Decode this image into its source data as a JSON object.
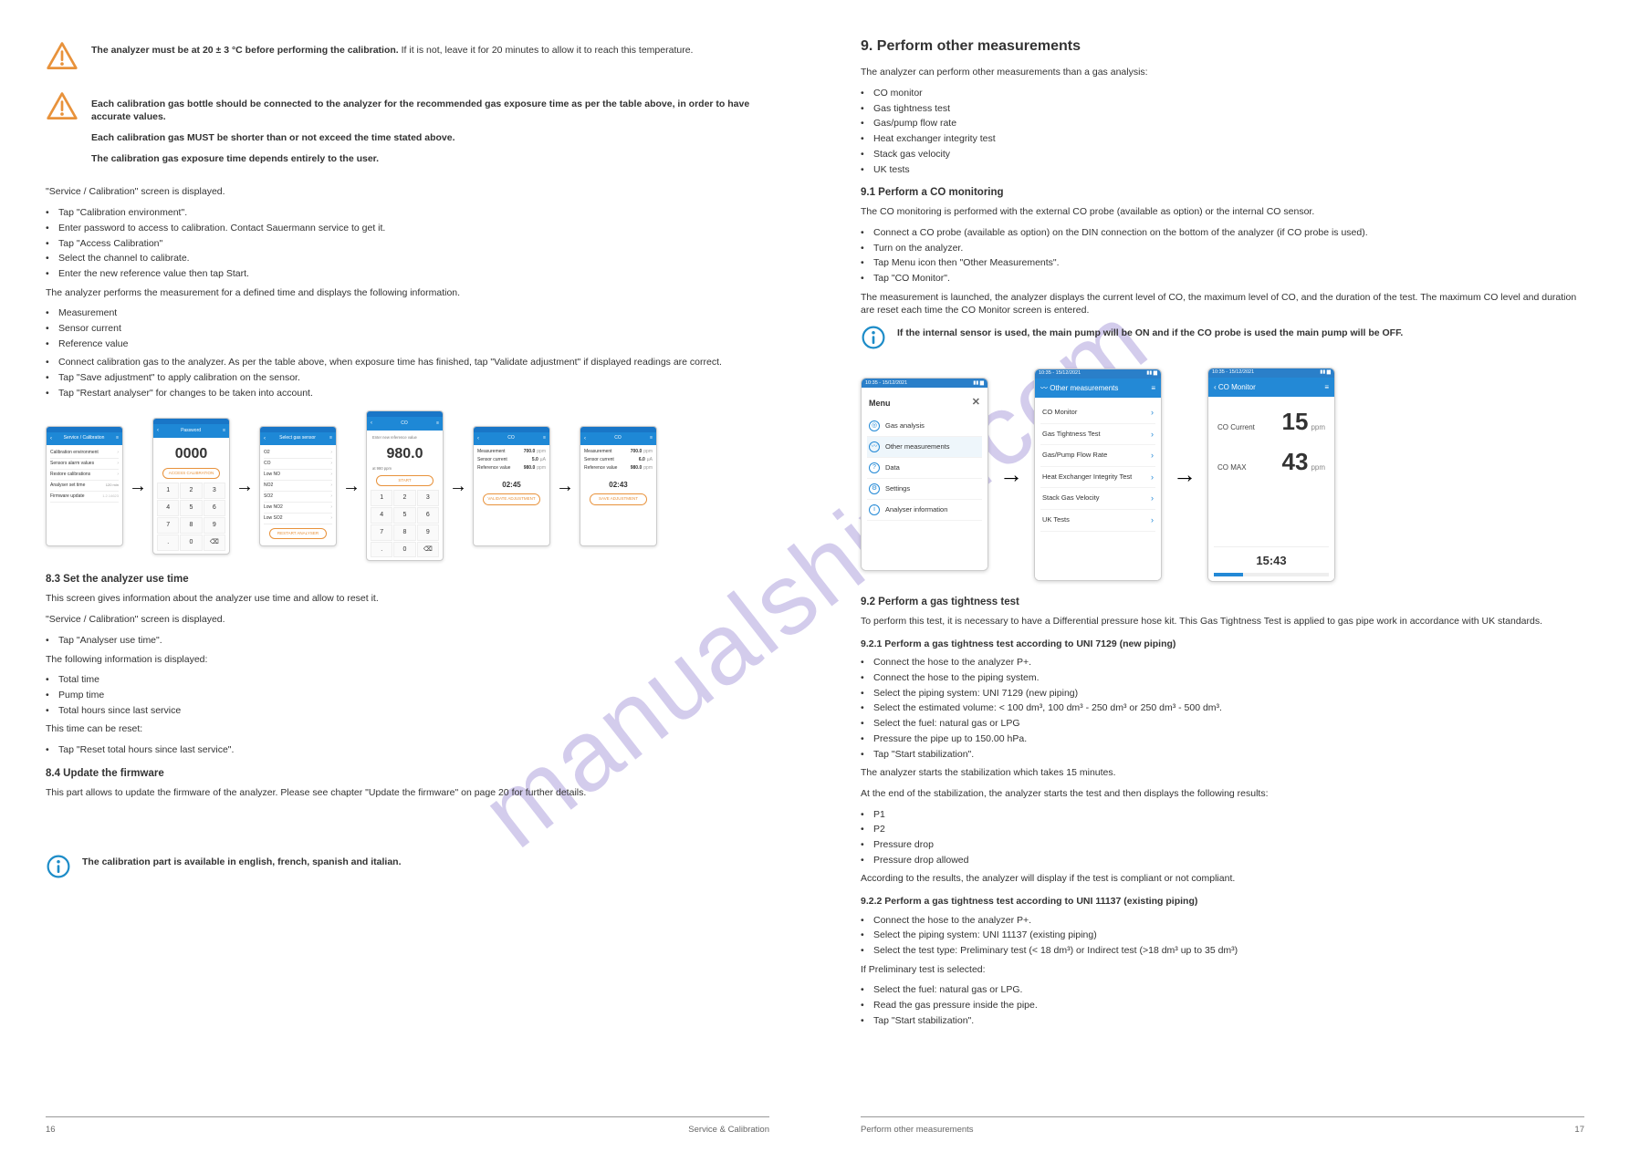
{
  "watermark": "manualshive.com",
  "left": {
    "warn1": {
      "bold": "The analyzer must be at 20 ± 3 °C before performing the calibration.",
      "rest": " If it is not, leave it for 20 minutes to allow it to reach this temperature."
    },
    "warn2_a": "Each calibration gas bottle should be connected to the analyzer for the recommended gas exposure time as per the table above, in order to have accurate values.",
    "warn2_b": "Each calibration gas MUST be shorter than or not exceed the time stated above.",
    "warn2_c": "The calibration gas exposure time depends entirely to the user.",
    "para_cal_screen": "\"Service / Calibration\" screen is displayed.",
    "steps_a": [
      "Tap \"Calibration environment\".",
      "Enter password to access to calibration. Contact Sauermann service to get it.",
      "Tap \"Access Calibration\"",
      "Select the channel to calibrate.",
      "Enter the new reference value then tap Start."
    ],
    "para_apply": "The analyzer performs the measurement for a defined time and displays the following information.",
    "info_items": [
      "Measurement",
      "Sensor current",
      "Reference value"
    ],
    "steps_b": [
      "Connect calibration gas to the analyzer. As per the table above, when exposure time has finished, tap \"Validate adjustment\" if displayed readings are correct.",
      "Tap \"Save adjustment\" to apply calibration on the sensor.",
      "Tap \"Restart analyser\" for changes to be taken into account."
    ],
    "flow": {
      "s1": {
        "title": "Service / Calibration",
        "rows": [
          "Calibration environment",
          "Sensors alarm values",
          "Restore calibrations",
          "Analyser set time",
          "Firmware update"
        ]
      },
      "s2": {
        "title": "Password",
        "val": "0000",
        "btn": "ACCESS CALIBRATION"
      },
      "s3": {
        "title": "Select gas sensor",
        "rows": [
          "O2",
          "CO",
          "Low NO",
          "NO2",
          "SO2",
          "Low NO2",
          "Low SO2"
        ],
        "btn": "RESTART ANALYSER"
      },
      "s4": {
        "title": "CO",
        "lbl": "Enter new reference value",
        "val": "980.0",
        "unit": "at 980 ppm",
        "btn": "START"
      },
      "s5": {
        "title": "CO",
        "rows": [
          [
            "Measurement",
            "700.0",
            "ppm"
          ],
          [
            "Sensor current",
            "5.0",
            "µA"
          ],
          [
            "Reference value",
            "980.0",
            "ppm"
          ]
        ],
        "time": "02:45",
        "btn": "VALIDATE ADJUSTMENT"
      },
      "s6": {
        "title": "CO",
        "rows": [
          [
            "Measurement",
            "700.0",
            "ppm"
          ],
          [
            "Sensor current",
            "6.0",
            "µA"
          ],
          [
            "Reference value",
            "980.0",
            "ppm"
          ]
        ],
        "time": "02:43",
        "btn": "SAVE ADJUSTMENT"
      }
    },
    "sect_83": "8.3 Set the analyzer use time",
    "p83_intro": "This screen gives information about the analyzer use time and allow to reset it.",
    "p83_nav": "\"Service / Calibration\" screen is displayed.",
    "p83_step": "Tap \"Analyser use time\".",
    "p83_list_intro": "The following information is displayed:",
    "p83_items": [
      "Total time",
      "Pump time",
      "Total hours since last service"
    ],
    "p83_reset": "This time can be reset:",
    "p83_reset_step": "Tap \"Reset total hours since last service\".",
    "sect_84": "8.4 Update the firmware",
    "p84": "This part allows to update the firmware of the analyzer. Please see chapter \"Update the firmware\" on page 20 for further details.",
    "info_llang": "The calibration part is available in english, french, spanish and italian.",
    "footer_num": "16",
    "footer_txt": "Service & Calibration"
  },
  "right": {
    "chapter": "9. Perform other measurements",
    "intro": "The analyzer can perform other measurements than a gas analysis:",
    "items": [
      "CO monitor",
      "Gas tightness test",
      "Gas/pump flow rate",
      "Heat exchanger integrity test",
      "Stack gas velocity",
      "UK tests"
    ],
    "sect_91": "9.1 Perform a CO monitoring",
    "p91_a": "The CO monitoring is performed with the external CO probe (available as option) or the internal CO sensor.",
    "p91_steps": [
      "Connect a CO probe (available as option) on the DIN connection on the bottom of the analyzer (if CO probe is used).",
      "Turn on the analyzer.",
      "Tap Menu icon then \"Other Measurements\".",
      "Tap \"CO Monitor\"."
    ],
    "p91_b": "The measurement is launched, the analyzer displays the current level of CO, the maximum level of CO, and the duration of the test. The maximum CO level and duration are reset each time the CO Monitor screen is entered.",
    "info_internal": "If the internal sensor is used, the main pump will be ON and if the CO probe is used the main pump will be OFF.",
    "flow": {
      "status": "10:35 - 15/12/2021",
      "menu": {
        "title": "Menu",
        "items": [
          "Gas analysis",
          "Other measurements",
          "Data",
          "Settings",
          "Analyser information"
        ],
        "selected": 1
      },
      "other": {
        "title": "Other measurements",
        "items": [
          "CO Monitor",
          "Gas Tightness Test",
          "Gas/Pump Flow Rate",
          "Heat Exchanger Integrity Test",
          "Stack Gas Velocity",
          "UK Tests"
        ]
      },
      "co": {
        "title": "CO Monitor",
        "cur_lbl": "CO Current",
        "cur_val": "15",
        "max_lbl": "CO MAX",
        "max_val": "43",
        "unit": "ppm",
        "timer": "15:43"
      }
    },
    "sect_92": "9.2 Perform a gas tightness test",
    "p92_a": "To perform this test, it is necessary to have a Differential pressure hose kit. This Gas Tightness Test is applied to gas pipe work in accordance with UK standards.",
    "sub_921": "9.2.1 Perform a gas tightness test according to UNI 7129 (new piping)",
    "p921_steps": [
      "Connect the hose to the analyzer P+.",
      "Connect the hose to the piping system.",
      "Select the piping system: UNI 7129 (new piping)",
      "Select the estimated volume: < 100 dm³, 100 dm³ - 250 dm³ or 250 dm³ - 500 dm³.",
      "Select the fuel: natural gas or LPG",
      "Pressure the pipe up to 150.00 hPa.",
      "Tap \"Start stabilization\"."
    ],
    "p921_stab": "The analyzer starts the stabilization which takes 15 minutes.",
    "p921_end": "At the end of the stabilization, the analyzer starts the test and then displays the following results:",
    "p921_res": [
      "P1",
      "P2",
      "Pressure drop",
      "Pressure drop allowed"
    ],
    "p921_comp": "According to the results, the analyzer will display if the test is compliant or not compliant.",
    "sub_922": "9.2.2 Perform a gas tightness test according to UNI 11137 (existing piping)",
    "p922_steps": [
      "Connect the hose to the analyzer P+.",
      "Select the piping system: UNI 11137 (existing piping)",
      "Select the test type: Preliminary test (< 18 dm³) or Indirect test (>18 dm³ up to 35 dm³)"
    ],
    "p922_pre": "If Preliminary test is selected:",
    "p922_pre_steps": [
      "Select the fuel: natural gas or LPG.",
      "Read the gas pressure inside the pipe.",
      "Tap \"Start stabilization\"."
    ],
    "footer_txt": "Perform other measurements",
    "footer_num": "17"
  }
}
